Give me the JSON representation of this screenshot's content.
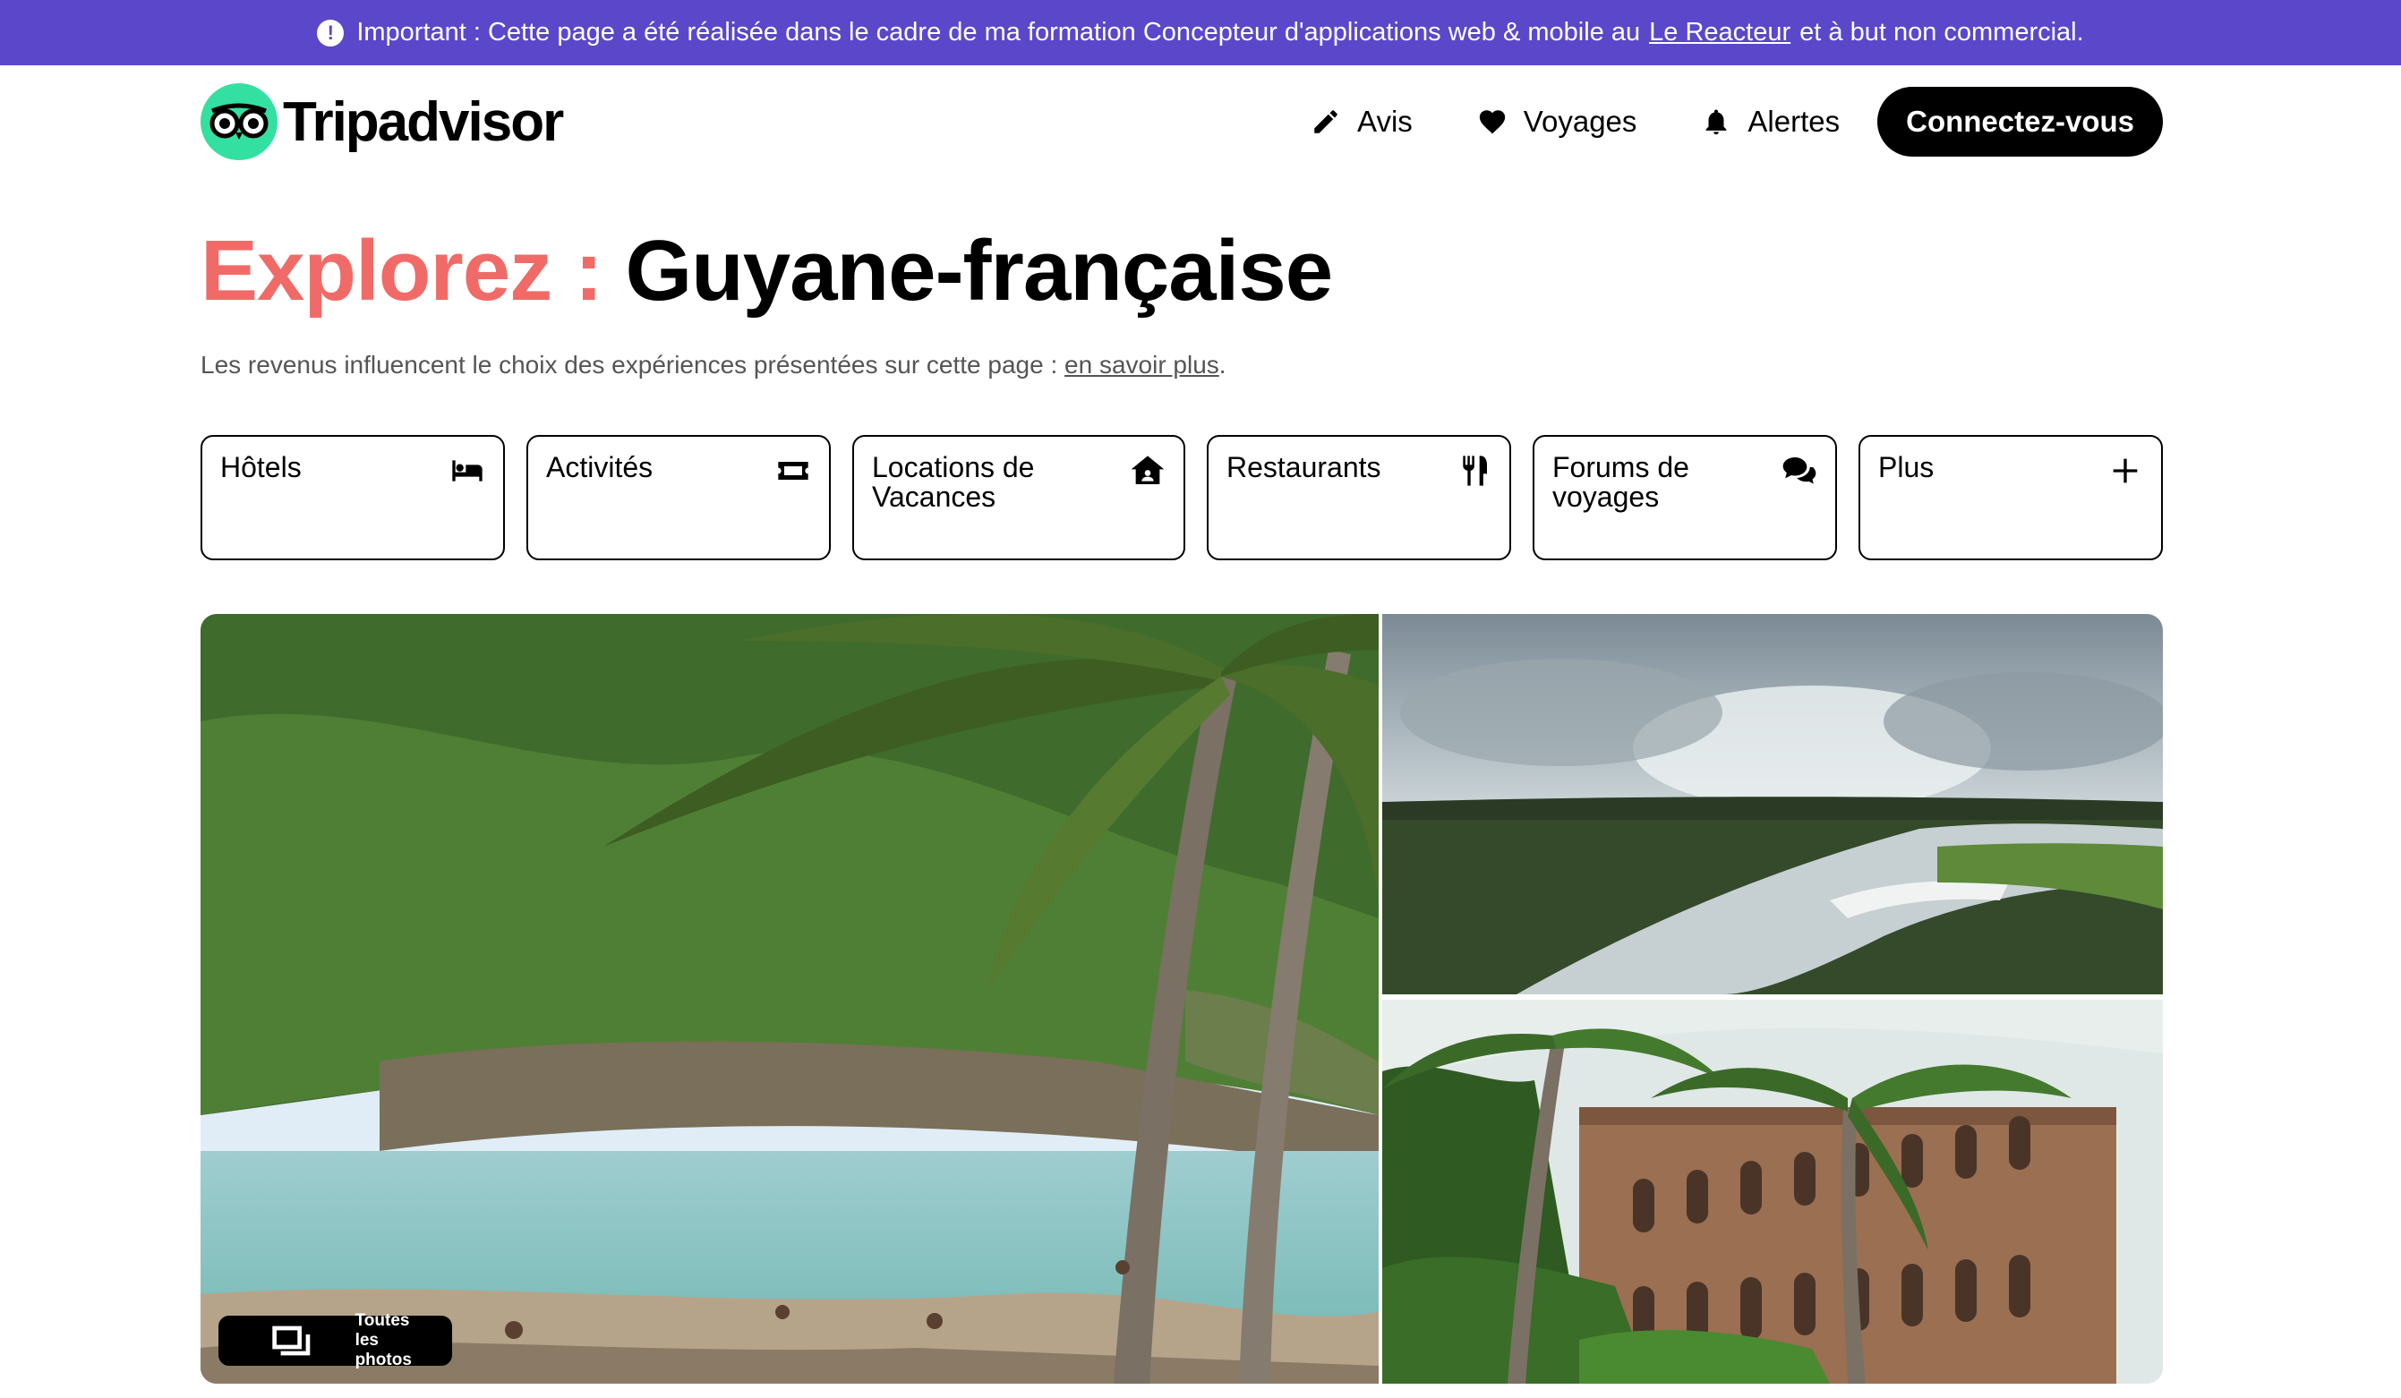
{
  "banner": {
    "text_before": "Important : Cette page a été réalisée dans le cadre de ma formation Concepteur d'applications web & mobile au",
    "link": "Le Reacteur",
    "text_after": "et à but non commercial."
  },
  "header": {
    "logo_text": "Tripadvisor",
    "nav": {
      "avis": "Avis",
      "voyages": "Voyages",
      "alertes": "Alertes"
    },
    "login": "Connectez-vous"
  },
  "page": {
    "title_prefix": "Explorez :",
    "title_place": "Guyane-française",
    "subtitle_text": "Les revenus influencent le choix des expériences présentées sur cette page :",
    "subtitle_link": "en savoir plus",
    "subtitle_end": "."
  },
  "categories": {
    "hotels": "Hôtels",
    "activites": "Activités",
    "locations": "Locations de Vacances",
    "restaurants": "Restaurants",
    "forums": "Forums de voyages",
    "plus": "Plus"
  },
  "gallery": {
    "all_photos": "Toutes les photos"
  },
  "colors": {
    "banner": "#5b47c9",
    "brand_green": "#34e0a1",
    "title_accent": "#f06b67"
  },
  "icons": [
    "info-icon",
    "pencil-icon",
    "heart-icon",
    "bell-icon",
    "bed-icon",
    "ticket-icon",
    "house-icon",
    "utensils-icon",
    "chat-icon",
    "plus-icon",
    "photos-icon"
  ]
}
